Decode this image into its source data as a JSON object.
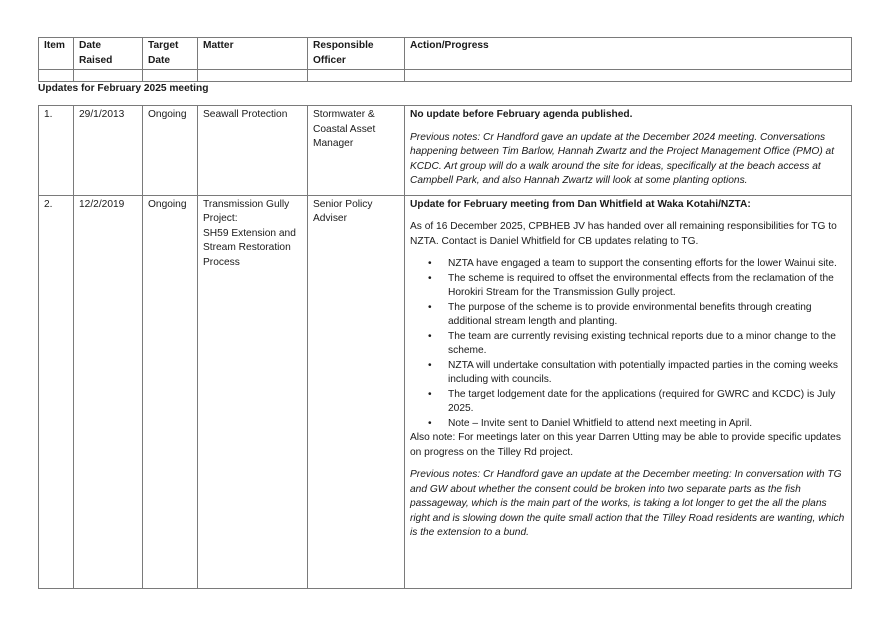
{
  "columns": [
    "Item",
    "Date Raised",
    "Target Date",
    "Matter",
    "Responsible Officer",
    "Action/Progress"
  ],
  "section_heading": "Updates for February 2025 meeting",
  "rows": [
    {
      "item": "1.",
      "date_raised": "29/1/2013",
      "target_date": "Ongoing",
      "matter": "Seawall Protection",
      "officer": "Stormwater & Coastal Asset Manager",
      "update_heading": "No update before February agenda published.",
      "previous_notes": "Previous notes: Cr Handford gave an update at the December 2024 meeting. Conversations happening between Tim Barlow, Hannah Zwartz and the Project Management Office (PMO) at KCDC. Art group will do a walk around the site for ideas, specifically at the beach access at Campbell Park, and also Hannah Zwartz will look at some planting options."
    },
    {
      "item": "2.",
      "date_raised": "12/2/2019",
      "target_date": "Ongoing",
      "matter_lines": [
        "Transmission Gully Project:",
        "SH59 Extension and Stream Restoration Process"
      ],
      "officer": "Senior Policy Adviser",
      "update_heading": "Update for February meeting from Dan Whitfield at Waka Kotahi/NZTA:",
      "intro": "As of 16 December 2025, CPBHEB JV has handed over all remaining responsibilities for TG to NZTA. Contact is Daniel Whitfield for CB updates relating to TG.",
      "bullets": [
        "NZTA have engaged a team to support the consenting efforts for the lower Wainui site.",
        "The scheme is required to offset the environmental effects from the reclamation of the Horokiri Stream for the Transmission Gully project.",
        "The purpose of the scheme is to provide environmental benefits through creating additional stream length and planting.",
        "The team are currently revising existing technical reports due to a minor change to the scheme.",
        "NZTA will undertake consultation with potentially impacted parties in the coming weeks including with councils.",
        "The target lodgement date for the applications (required for GWRC and KCDC) is July 2025.",
        "Note – Invite sent to Daniel Whitfield to attend next meeting in April."
      ],
      "also_note": "Also note: For meetings later on this year Darren Utting may be able to provide specific updates on progress on the Tilley Rd project.",
      "previous_notes": "Previous notes: Cr Handford gave an update at the December meeting: In conversation with TG and GW about whether the consent could be broken into two separate parts as the fish passageway, which is the main part of the works, is taking a lot longer to get the all the plans right and is slowing down the quite small action that the Tilley Road residents are wanting, which is the extension to a bund."
    }
  ]
}
